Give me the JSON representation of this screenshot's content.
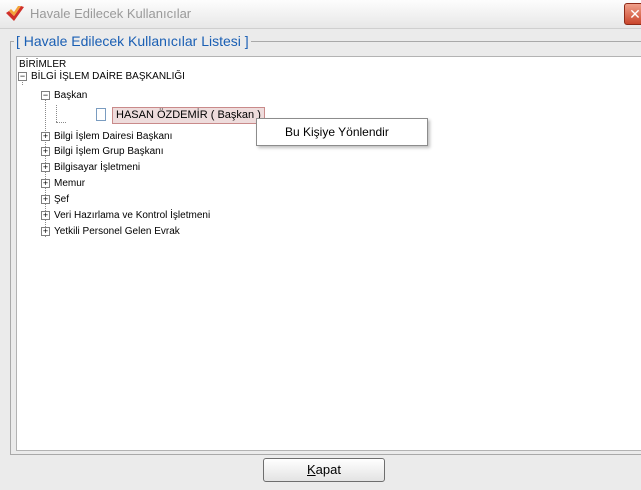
{
  "window": {
    "title": "Havale Edilecek Kullanıcılar",
    "close_label": "✕"
  },
  "group": {
    "legend": "[ Havale Edilecek Kullanıcılar Listesi ]"
  },
  "tree": {
    "root_label": "BİRİMLER",
    "department": "BİLGİ İŞLEM DAİRE BAŞKANLIĞI",
    "expanded_child": "Başkan",
    "selected_user": "HASAN ÖZDEMİR ( Başkan )",
    "items": [
      "Bilgi İşlem Dairesi Başkanı",
      "Bilgi İşlem Grup Başkanı",
      "Bilgisayar İşletmeni",
      "Memur",
      "Şef",
      "Veri Hazırlama ve Kontrol İşletmeni",
      "Yetkili Personel Gelen Evrak"
    ],
    "expand_symbol": "+",
    "collapse_symbol": "−"
  },
  "context_menu": {
    "item": "Bu Kişiye Yönlendir"
  },
  "footer": {
    "close_button_first": "K",
    "close_button_rest": "apat"
  },
  "colors": {
    "legend": "#1a5fb4",
    "selection": "#eedcdc",
    "close": "#c9462c"
  }
}
